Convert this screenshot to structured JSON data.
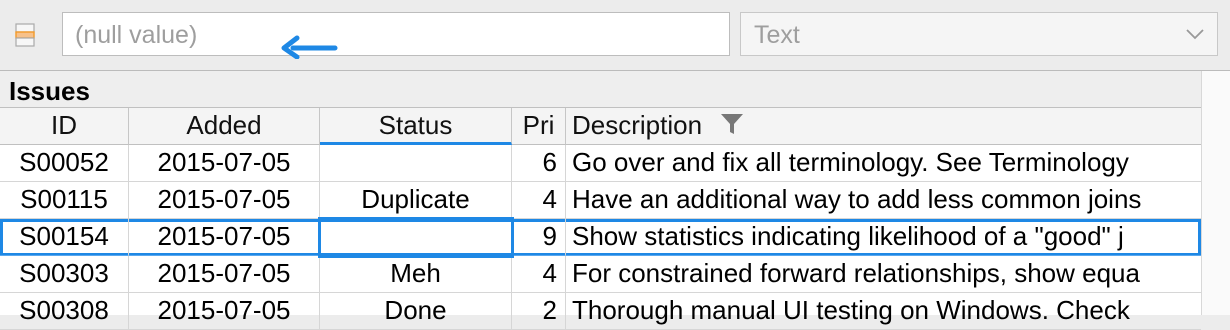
{
  "toolbar": {
    "icon": "table-row-icon",
    "value_placeholder": "(null value)",
    "type_select": "Text"
  },
  "grid": {
    "group_title": "Issues",
    "columns": [
      "ID",
      "Added",
      "Status",
      "Pri",
      "Description"
    ],
    "rows": [
      {
        "id": "S00052",
        "added": "2015-07-05",
        "status": "",
        "pri": "6",
        "description": "Go over and fix all terminology. See Terminology"
      },
      {
        "id": "S00115",
        "added": "2015-07-05",
        "status": "Duplicate",
        "pri": "4",
        "description": "Have an additional way to add less common joins"
      },
      {
        "id": "S00154",
        "added": "2015-07-05",
        "status": "",
        "pri": "9",
        "description": "Show statistics indicating likelihood of a \"good\" j"
      },
      {
        "id": "S00303",
        "added": "2015-07-05",
        "status": "Meh",
        "pri": "4",
        "description": "For constrained forward relationships, show equa"
      },
      {
        "id": "S00308",
        "added": "2015-07-05",
        "status": "Done",
        "pri": "2",
        "description": "Thorough manual UI testing on Windows. Check"
      }
    ]
  },
  "colors": {
    "accent": "#1e88e5",
    "arrow": "#1e88e5",
    "icon_orange": "#f39a28"
  }
}
